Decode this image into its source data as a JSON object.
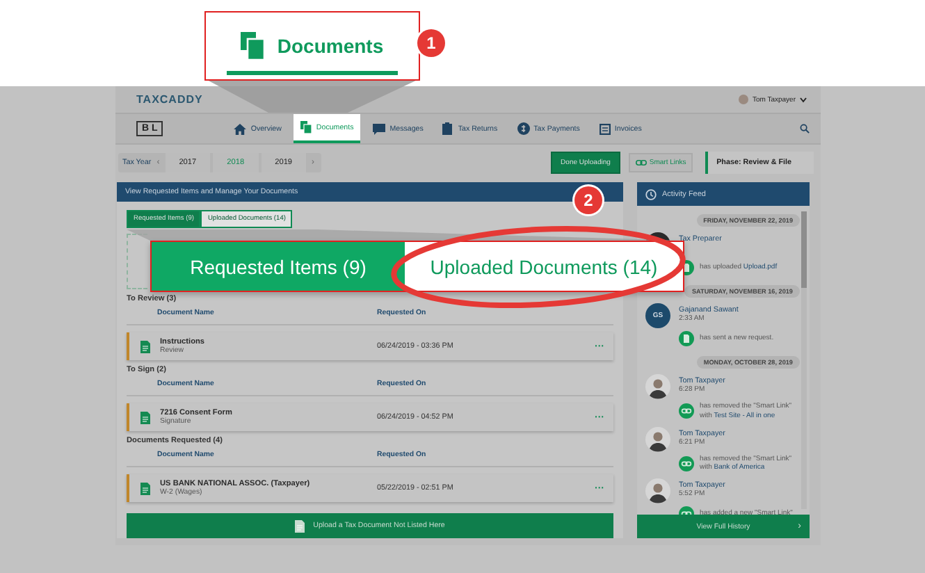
{
  "callout_1": {
    "label": "Documents",
    "badge": "1"
  },
  "logo": "TAXCADDY",
  "user": {
    "name": "Tom Taxpayer"
  },
  "firm_logo": "BL",
  "nav": [
    {
      "label": "Overview",
      "kind": "home",
      "selected": false
    },
    {
      "label": "Documents",
      "kind": "documents",
      "selected": true
    },
    {
      "label": "Messages",
      "kind": "chat",
      "selected": false
    },
    {
      "label": "Tax Returns",
      "kind": "returns",
      "selected": false
    },
    {
      "label": "Tax Payments",
      "kind": "payments",
      "selected": false
    },
    {
      "label": "Invoices",
      "kind": "invoice",
      "selected": false
    }
  ],
  "tax_year": {
    "label": "Tax Year",
    "prev": "‹",
    "next": "›",
    "years": [
      {
        "label": "2017",
        "selected": false
      },
      {
        "label": "2018",
        "selected": true
      },
      {
        "label": "2019",
        "selected": false
      }
    ]
  },
  "done_button": "Done Uploading",
  "smart_links_button": "Smart Links",
  "phase": "Phase: Review & File",
  "panel": {
    "title": "View Requested Items and Manage Your Documents",
    "tabs": [
      {
        "label": "Requested Items (9)",
        "selected": true
      },
      {
        "label": "Uploaded Documents (14)",
        "selected": false
      }
    ],
    "sections": [
      {
        "title": "To Review",
        "count": "(3)",
        "columns": [
          "Document Name",
          "Requested On"
        ],
        "rows": [
          {
            "name": "Instructions",
            "type": "Review",
            "date": "06/24/2019 - 03:36 PM",
            "menu": "···"
          }
        ]
      },
      {
        "title": "To Sign",
        "count": "(2)",
        "columns": [
          "Document Name",
          "Requested On"
        ],
        "rows": [
          {
            "name": "7216 Consent Form",
            "type": "Signature",
            "date": "06/24/2019 - 04:52 PM",
            "menu": "···"
          }
        ]
      },
      {
        "title": "Documents Requested",
        "count": "(4)",
        "columns": [
          "Document Name",
          "Requested On"
        ],
        "rows": [
          {
            "name": "US BANK NATIONAL ASSOC. (Taxpayer)",
            "type": "W-2 (Wages)",
            "date": "05/22/2019 - 02:51 PM",
            "menu": "···"
          }
        ]
      }
    ],
    "upload_button": "Upload a Tax Document Not Listed Here"
  },
  "callout_2": {
    "badge": "2",
    "tabs": [
      {
        "label": "Requested Items (9)",
        "selected": true
      },
      {
        "label": "Uploaded Documents (14)",
        "selected": false
      }
    ]
  },
  "feed": {
    "title": "Activity Feed",
    "groups": [
      {
        "date": "FRIDAY, NOVEMBER 22, 2019",
        "entries": [
          {
            "avatar": {
              "kind": "dark"
            },
            "name": "Tax Preparer",
            "kind": "document",
            "text": "has uploaded",
            "link": "Upload.pdf"
          }
        ]
      },
      {
        "date": "SATURDAY, NOVEMBER 16, 2019",
        "entries": [
          {
            "avatar": {
              "kind": "initials",
              "text": "GS"
            },
            "name": "Gajanand Sawant",
            "time": "2:33 AM",
            "kind": "document",
            "text": "has sent a new request."
          }
        ]
      },
      {
        "date": "MONDAY, OCTOBER 28, 2019",
        "entries": [
          {
            "avatar": {
              "kind": "person"
            },
            "name": "Tom Taxpayer",
            "time": "6:28 PM",
            "kind": "link",
            "text": "has removed the \"Smart Link\" with",
            "link": "Test Site - All in one"
          },
          {
            "avatar": {
              "kind": "person"
            },
            "name": "Tom Taxpayer",
            "time": "6:21 PM",
            "kind": "link",
            "text": "has removed the \"Smart Link\" with",
            "link": "Bank of America"
          },
          {
            "avatar": {
              "kind": "person"
            },
            "name": "Tom Taxpayer",
            "time": "5:52 PM",
            "kind": "link",
            "text": "has added a new \"Smart Link\""
          }
        ]
      }
    ],
    "history_button": "View Full History",
    "history_arrow": "›"
  }
}
